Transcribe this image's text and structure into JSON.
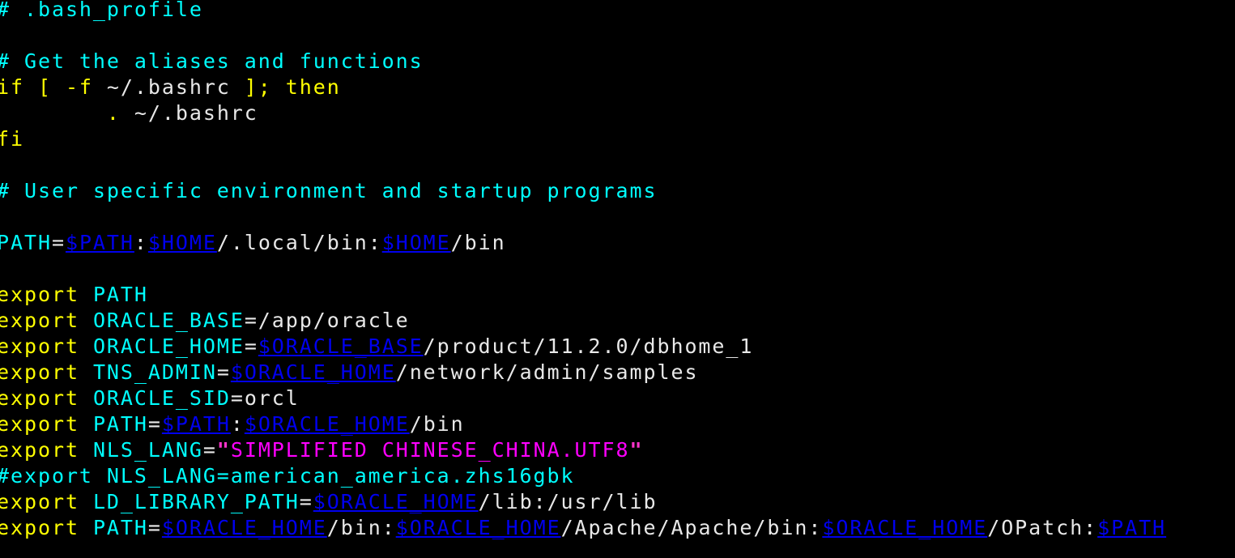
{
  "terminal": {
    "window_title": ".bash_profile",
    "background_color": "#000000",
    "font_size_px": 25,
    "line_height_px": 32,
    "columns_visible": 91,
    "colors": {
      "comment": "#00ffff",
      "keyword": "#ffff00",
      "identifier": "#00ffff",
      "variable": "#0000ee",
      "plain": "#e8e8e8",
      "string": "#ff00ff",
      "quote": "#ff33cc"
    }
  },
  "file": {
    "name": ".bash_profile",
    "lines": [
      {
        "n": 1,
        "text": "# .bash_profile",
        "tokens": [
          {
            "t": "# .bash_profile",
            "c": "comment"
          }
        ]
      },
      {
        "n": 2,
        "text": "",
        "tokens": []
      },
      {
        "n": 3,
        "text": "# Get the aliases and functions",
        "tokens": [
          {
            "t": "# Get the aliases and functions",
            "c": "comment"
          }
        ]
      },
      {
        "n": 4,
        "text": "if [ -f ~/.bashrc ]; then",
        "tokens": [
          {
            "t": "if [ -f ",
            "c": "keyword"
          },
          {
            "t": "~/.bashrc",
            "c": "plain"
          },
          {
            "t": " ]; then",
            "c": "keyword"
          }
        ]
      },
      {
        "n": 5,
        "text": "        . ~/.bashrc",
        "tokens": [
          {
            "t": "        .",
            "c": "keyword"
          },
          {
            "t": " ~/.bashrc",
            "c": "plain"
          }
        ]
      },
      {
        "n": 6,
        "text": "fi",
        "tokens": [
          {
            "t": "fi",
            "c": "keyword"
          }
        ]
      },
      {
        "n": 7,
        "text": "",
        "tokens": []
      },
      {
        "n": 8,
        "text": "# User specific environment and startup programs",
        "tokens": [
          {
            "t": "# User specific environment and startup programs",
            "c": "comment"
          }
        ]
      },
      {
        "n": 9,
        "text": "",
        "tokens": []
      },
      {
        "n": 10,
        "text": "PATH=$PATH:$HOME/.local/bin:$HOME/bin",
        "tokens": [
          {
            "t": "PATH",
            "c": "identifier"
          },
          {
            "t": "=",
            "c": "plain"
          },
          {
            "t": "$PATH",
            "c": "variable"
          },
          {
            "t": ":",
            "c": "plain"
          },
          {
            "t": "$HOME",
            "c": "variable"
          },
          {
            "t": "/.local/bin:",
            "c": "plain"
          },
          {
            "t": "$HOME",
            "c": "variable"
          },
          {
            "t": "/bin",
            "c": "plain"
          }
        ]
      },
      {
        "n": 11,
        "text": "",
        "tokens": []
      },
      {
        "n": 12,
        "text": "export PATH",
        "tokens": [
          {
            "t": "export",
            "c": "keyword"
          },
          {
            "t": " ",
            "c": "plain"
          },
          {
            "t": "PATH",
            "c": "identifier"
          }
        ]
      },
      {
        "n": 13,
        "text": "export ORACLE_BASE=/app/oracle",
        "tokens": [
          {
            "t": "export",
            "c": "keyword"
          },
          {
            "t": " ",
            "c": "plain"
          },
          {
            "t": "ORACLE_BASE",
            "c": "identifier"
          },
          {
            "t": "=/app/oracle",
            "c": "plain"
          }
        ]
      },
      {
        "n": 14,
        "text": "export ORACLE_HOME=$ORACLE_BASE/product/11.2.0/dbhome_1",
        "tokens": [
          {
            "t": "export",
            "c": "keyword"
          },
          {
            "t": " ",
            "c": "plain"
          },
          {
            "t": "ORACLE_HOME",
            "c": "identifier"
          },
          {
            "t": "=",
            "c": "plain"
          },
          {
            "t": "$ORACLE_BASE",
            "c": "variable"
          },
          {
            "t": "/product/11.2.0/dbhome_1",
            "c": "plain"
          }
        ]
      },
      {
        "n": 15,
        "text": "export TNS_ADMIN=$ORACLE_HOME/network/admin/samples",
        "tokens": [
          {
            "t": "export",
            "c": "keyword"
          },
          {
            "t": " ",
            "c": "plain"
          },
          {
            "t": "TNS_ADMIN",
            "c": "identifier"
          },
          {
            "t": "=",
            "c": "plain"
          },
          {
            "t": "$ORACLE_HOME",
            "c": "variable"
          },
          {
            "t": "/network/admin/samples",
            "c": "plain"
          }
        ]
      },
      {
        "n": 16,
        "text": "export ORACLE_SID=orcl",
        "tokens": [
          {
            "t": "export",
            "c": "keyword"
          },
          {
            "t": " ",
            "c": "plain"
          },
          {
            "t": "ORACLE_SID",
            "c": "identifier"
          },
          {
            "t": "=orcl",
            "c": "plain"
          }
        ]
      },
      {
        "n": 17,
        "text": "export PATH=$PATH:$ORACLE_HOME/bin",
        "tokens": [
          {
            "t": "export",
            "c": "keyword"
          },
          {
            "t": " ",
            "c": "plain"
          },
          {
            "t": "PATH",
            "c": "identifier"
          },
          {
            "t": "=",
            "c": "plain"
          },
          {
            "t": "$PATH",
            "c": "variable"
          },
          {
            "t": ":",
            "c": "plain"
          },
          {
            "t": "$ORACLE_HOME",
            "c": "variable"
          },
          {
            "t": "/bin",
            "c": "plain"
          }
        ]
      },
      {
        "n": 18,
        "text": "export NLS_LANG=\"SIMPLIFIED CHINESE_CHINA.UTF8\"",
        "tokens": [
          {
            "t": "export",
            "c": "keyword"
          },
          {
            "t": " ",
            "c": "plain"
          },
          {
            "t": "NLS_LANG",
            "c": "identifier"
          },
          {
            "t": "=",
            "c": "plain"
          },
          {
            "t": "\"",
            "c": "quote"
          },
          {
            "t": "SIMPLIFIED CHINESE_CHINA.UTF8",
            "c": "string"
          },
          {
            "t": "\"",
            "c": "quote"
          }
        ]
      },
      {
        "n": 19,
        "text": "#export NLS_LANG=american_america.zhs16gbk",
        "tokens": [
          {
            "t": "#export NLS_LANG=american_america.zhs16gbk",
            "c": "comment"
          }
        ]
      },
      {
        "n": 20,
        "text": "export LD_LIBRARY_PATH=$ORACLE_HOME/lib:/usr/lib",
        "tokens": [
          {
            "t": "export",
            "c": "keyword"
          },
          {
            "t": " ",
            "c": "plain"
          },
          {
            "t": "LD_LIBRARY_PATH",
            "c": "identifier"
          },
          {
            "t": "=",
            "c": "plain"
          },
          {
            "t": "$ORACLE_HOME",
            "c": "variable"
          },
          {
            "t": "/lib:/usr/lib",
            "c": "plain"
          }
        ]
      },
      {
        "n": 21,
        "text": "export PATH=$ORACLE_HOME/bin:$ORACLE_HOME/Apache/Apache/bin:$ORACLE_HOME/OPatch:$PATH",
        "tokens": [
          {
            "t": "export",
            "c": "keyword"
          },
          {
            "t": " ",
            "c": "plain"
          },
          {
            "t": "PATH",
            "c": "identifier"
          },
          {
            "t": "=",
            "c": "plain"
          },
          {
            "t": "$ORACLE_HOME",
            "c": "variable"
          },
          {
            "t": "/bin:",
            "c": "plain"
          },
          {
            "t": "$ORACLE_HOME",
            "c": "variable"
          },
          {
            "t": "/Apache/Apache/bin:",
            "c": "plain"
          },
          {
            "t": "$ORACLE_HOME",
            "c": "variable"
          },
          {
            "t": "/OPatch:",
            "c": "plain"
          },
          {
            "t": "$PATH",
            "c": "variable"
          }
        ]
      }
    ]
  }
}
